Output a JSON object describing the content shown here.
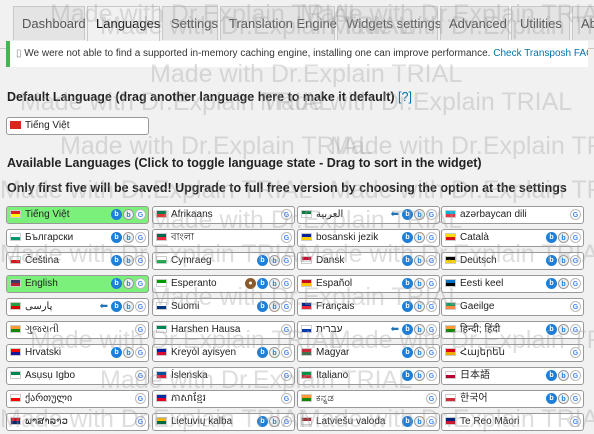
{
  "tabs": [
    "Dashboard",
    "Languages",
    "Settings",
    "Translation Engines",
    "Widgets settings",
    "Advanced",
    "Utilities",
    "Ab"
  ],
  "active_tab": "Languages",
  "notice": {
    "text": "We were not able to find a supported in-memory caching engine, installing one can improve performance.",
    "link": "Check Transposh FAQs"
  },
  "default_language": {
    "heading": "Default Language (drag another language here to make it default)",
    "help": "[?]",
    "value": "Tiếng Việt"
  },
  "available": {
    "heading": "Available Languages (Click to toggle language state - Drag to sort in the widget)",
    "note": "Only first five will be saved! Upgrade to full free version by choosing the option at the settings"
  },
  "watermark": "Made with Dr.Explain TRIAL",
  "colors": {
    "active": "#7bf07b",
    "notice_border": "#46b450",
    "link": "#0073aa"
  },
  "languages": [
    {
      "name": "Tiếng Việt",
      "active": true,
      "flag": [
        "#da251d",
        "#ffff00"
      ],
      "engines": [
        "b1",
        "b2",
        "g"
      ]
    },
    {
      "name": "Afrikaans",
      "flag": [
        "#007a4d",
        "#de3831"
      ],
      "engines": [
        "g"
      ]
    },
    {
      "name": "العربية",
      "flag": [
        "#007a3d",
        "#ffffff"
      ],
      "arrow": true,
      "engines": [
        "b1",
        "b2",
        "g"
      ]
    },
    {
      "name": "azərbaycan dili",
      "flag": [
        "#00b5e2",
        "#ef3340"
      ],
      "engines": [
        "g"
      ]
    },
    {
      "name": "Български",
      "flag": [
        "#ffffff",
        "#00966e"
      ],
      "engines": [
        "b1",
        "b2",
        "g"
      ]
    },
    {
      "name": "বাংলা",
      "flag": [
        "#006a4e",
        "#f42a41"
      ],
      "engines": [
        "g"
      ]
    },
    {
      "name": "bosanski jezik",
      "flag": [
        "#002395",
        "#fecb00"
      ],
      "engines": [
        "b1",
        "b2",
        "g"
      ]
    },
    {
      "name": "Català",
      "flag": [
        "#fcdd09",
        "#da121a"
      ],
      "engines": [
        "b1",
        "b2",
        "g"
      ]
    },
    {
      "name": "Čeština",
      "flag": [
        "#ffffff",
        "#d7141a"
      ],
      "engines": [
        "b1",
        "b2",
        "g"
      ]
    },
    {
      "name": "Cymraeg",
      "flag": [
        "#ffffff",
        "#00ab39"
      ],
      "engines": [
        "b1",
        "b2",
        "g"
      ]
    },
    {
      "name": "Dansk",
      "flag": [
        "#c60c30",
        "#ffffff"
      ],
      "engines": [
        "b1",
        "b2",
        "g"
      ]
    },
    {
      "name": "Deutsch",
      "flag": [
        "#000000",
        "#ffce00"
      ],
      "engines": [
        "b1",
        "b2",
        "g"
      ]
    },
    {
      "name": "English",
      "active": true,
      "flag": [
        "#3c3b6e",
        "#b22234"
      ],
      "engines": [
        "b1",
        "b2",
        "g"
      ]
    },
    {
      "name": "Esperanto",
      "flag": [
        "#009900",
        "#ffffff"
      ],
      "engines": [
        "m",
        "b1",
        "b2",
        "g"
      ]
    },
    {
      "name": "Español",
      "flag": [
        "#c60b1e",
        "#ffc400"
      ],
      "engines": [
        "b1",
        "b2",
        "g"
      ]
    },
    {
      "name": "Eesti keel",
      "flag": [
        "#0072ce",
        "#000000"
      ],
      "engines": [
        "b1",
        "b2",
        "g"
      ]
    },
    {
      "name": "پارسی",
      "flag": [
        "#239f40",
        "#da0000"
      ],
      "arrow": true,
      "engines": [
        "b1",
        "b2",
        "g"
      ]
    },
    {
      "name": "Suomi",
      "flag": [
        "#ffffff",
        "#003580"
      ],
      "engines": [
        "b1",
        "b2",
        "g"
      ]
    },
    {
      "name": "Français",
      "flag": [
        "#002395",
        "#ed2939"
      ],
      "engines": [
        "b1",
        "b2",
        "g"
      ]
    },
    {
      "name": "Gaeilge",
      "flag": [
        "#169b62",
        "#ff883e"
      ],
      "engines": [
        "g"
      ]
    },
    {
      "name": "ગુજરાતી",
      "flag": [
        "#ff9933",
        "#138808"
      ],
      "engines": [
        "g"
      ]
    },
    {
      "name": "Harshen Hausa",
      "flag": [
        "#008751",
        "#ffffff"
      ],
      "engines": [
        "g"
      ]
    },
    {
      "name": "עברית",
      "flag": [
        "#ffffff",
        "#0038b8"
      ],
      "arrow": true,
      "engines": [
        "b1",
        "b2",
        "g"
      ]
    },
    {
      "name": "हिन्दी; हिंदी",
      "flag": [
        "#ff9933",
        "#138808"
      ],
      "engines": [
        "b1",
        "b2",
        "g"
      ]
    },
    {
      "name": "Hrvatski",
      "flag": [
        "#ff0000",
        "#171796"
      ],
      "engines": [
        "b1",
        "b2",
        "g"
      ]
    },
    {
      "name": "Kreyòl ayisyen",
      "flag": [
        "#00209f",
        "#d21034"
      ],
      "engines": [
        "b1",
        "b2",
        "g"
      ]
    },
    {
      "name": "Magyar",
      "flag": [
        "#ce2939",
        "#477050"
      ],
      "engines": [
        "b1",
        "b2",
        "g"
      ]
    },
    {
      "name": "Հայերեն",
      "flag": [
        "#d90012",
        "#f2a800"
      ],
      "engines": [
        "g"
      ]
    },
    {
      "name": "Asụsụ Igbo",
      "flag": [
        "#008751",
        "#ffffff"
      ],
      "engines": [
        "g"
      ]
    },
    {
      "name": "Íslenska",
      "flag": [
        "#02529c",
        "#dc1e35"
      ],
      "engines": [
        "g"
      ]
    },
    {
      "name": "Italiano",
      "flag": [
        "#009246",
        "#ce2b37"
      ],
      "engines": [
        "b1",
        "b2",
        "g"
      ]
    },
    {
      "name": "日本語",
      "flag": [
        "#ffffff",
        "#bc002d"
      ],
      "engines": [
        "b1",
        "b2",
        "g"
      ]
    },
    {
      "name": "ქართული",
      "flag": [
        "#ffffff",
        "#ff0000"
      ],
      "engines": [
        "g"
      ]
    },
    {
      "name": "ភាសាខ្មែរ",
      "flag": [
        "#032ea1",
        "#e00025"
      ],
      "engines": [
        "g"
      ]
    },
    {
      "name": "ಕನ್ನಡ",
      "flag": [
        "#ff9933",
        "#138808"
      ],
      "engines": [
        "g"
      ]
    },
    {
      "name": "한국어",
      "flag": [
        "#ffffff",
        "#cd2e3a"
      ],
      "engines": [
        "b1",
        "b2",
        "g"
      ]
    },
    {
      "name": "ພາສາລາວ",
      "flag": [
        "#ce1126",
        "#002868"
      ],
      "engines": [
        "g"
      ]
    },
    {
      "name": "Lietuvių kalba",
      "flag": [
        "#fdb913",
        "#006a44"
      ],
      "engines": [
        "b1",
        "b2",
        "g"
      ]
    },
    {
      "name": "Latviešu valoda",
      "flag": [
        "#9e3039",
        "#ffffff"
      ],
      "engines": [
        "b1",
        "b2",
        "g"
      ]
    },
    {
      "name": "Te Reo Māori",
      "flag": [
        "#00247d",
        "#cc142b"
      ],
      "engines": [
        "g"
      ]
    }
  ]
}
